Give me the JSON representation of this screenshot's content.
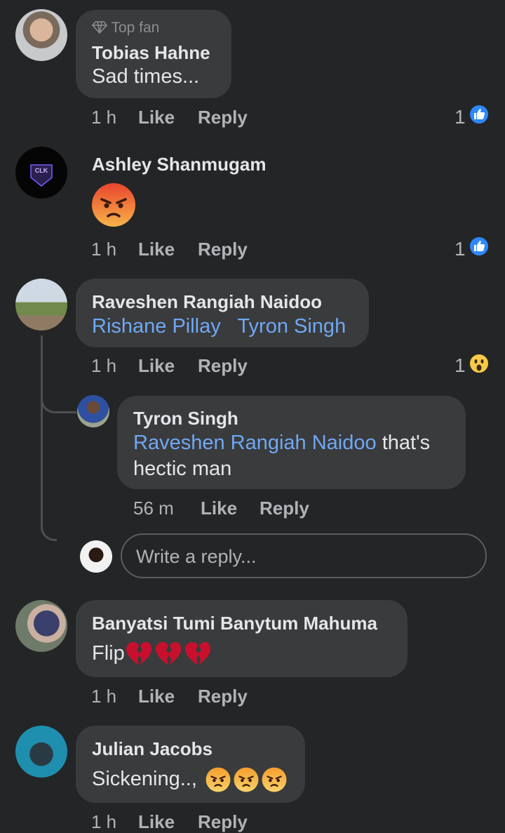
{
  "comments": [
    {
      "badge": "Top fan",
      "author": "Tobias Hahne",
      "text": "Sad times...",
      "time": "1 h",
      "like": "Like",
      "reply": "Reply",
      "reaction_count": "1",
      "reaction": "like-reaction-icon"
    },
    {
      "author": "Ashley Shanmugam",
      "content": "angry-emoji-icon",
      "time": "1 h",
      "like": "Like",
      "reply": "Reply",
      "reaction_count": "1",
      "reaction": "like-reaction-icon",
      "avatar_text": "CLK"
    },
    {
      "author": "Raveshen Rangiah Naidoo",
      "mentions": [
        "Rishane Pillay",
        "Tyron Singh"
      ],
      "time": "1 h",
      "like": "Like",
      "reply": "Reply",
      "reaction_count": "1",
      "reaction": "wow-reaction-icon",
      "replies": [
        {
          "author": "Tyron Singh",
          "mention": "Raveshen Rangiah Naidoo",
          "text_after_mention": " that's",
          "text_line2": "hectic man",
          "time": "56 m",
          "like": "Like",
          "reply": "Reply"
        }
      ]
    },
    {
      "author": "Banyatsi Tumi Banytum Mahuma",
      "text": "Flip",
      "emojis": [
        "broken-heart-icon",
        "broken-heart-icon",
        "broken-heart-icon"
      ],
      "time": "1 h",
      "like": "Like",
      "reply": "Reply"
    },
    {
      "author": "Julian Jacobs",
      "text": "Sickening..,",
      "emojis": [
        "angry-emoji-icon",
        "angry-emoji-icon",
        "angry-emoji-icon"
      ],
      "time": "1 h",
      "like": "Like",
      "reply": "Reply"
    }
  ],
  "reply_box": {
    "placeholder": "Write a reply..."
  },
  "colors": {
    "background": "#242526",
    "bubble": "#3a3b3c",
    "mention": "#6fa8f5",
    "like_blue": "#2d88ff",
    "angry_red": "#e8452c",
    "wow_yellow": "#f7c948"
  }
}
